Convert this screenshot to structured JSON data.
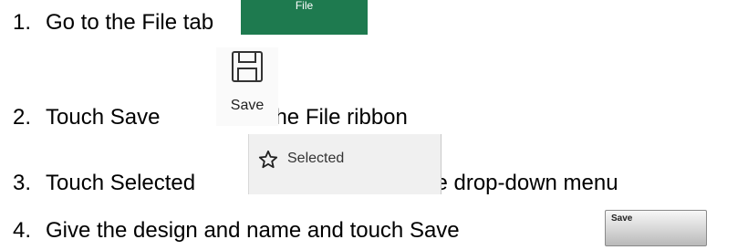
{
  "steps": [
    {
      "number": "1.",
      "text_before": "Go to the File tab",
      "text_after": ""
    },
    {
      "number": "2.",
      "text_before": "Touch Save",
      "text_after": "on the File ribbon"
    },
    {
      "number": "3.",
      "text_before": "Touch Selected",
      "text_after": "in the drop-down menu"
    },
    {
      "number": "4.",
      "text_before": "Give the design and name and touch Save",
      "text_after": ""
    }
  ],
  "file_tab": {
    "label": "File",
    "color": "#1e7a4f"
  },
  "save_ribbon": {
    "label": "Save",
    "icon": "floppy-disk-icon"
  },
  "selected_item": {
    "label": "Selected",
    "icon": "star-outline-icon"
  },
  "save_button": {
    "label": "Save"
  }
}
